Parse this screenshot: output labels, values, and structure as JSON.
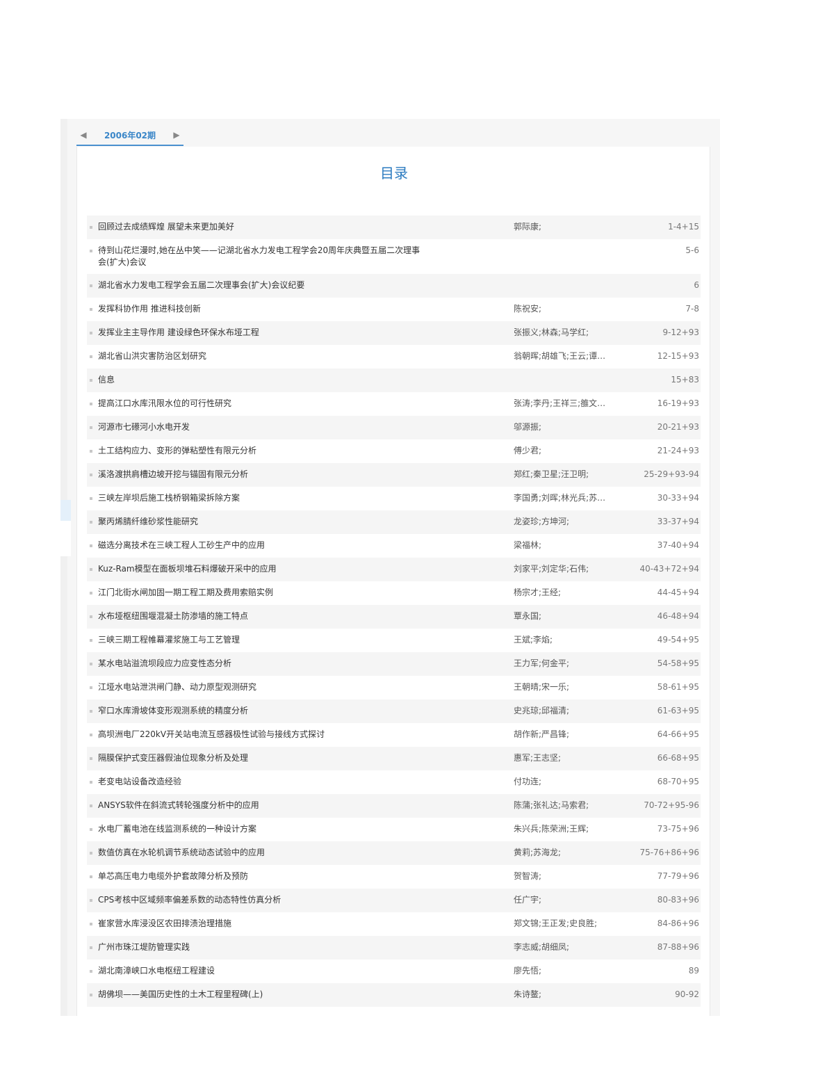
{
  "issue": {
    "label": "2006年02期",
    "prev_icon": "◀",
    "next_icon": "▶"
  },
  "toc": {
    "title": "目录",
    "articles": [
      {
        "title": "回顾过去成绩辉煌 展望未来更加美好",
        "authors": "郭际康;",
        "pages": "1-4+15"
      },
      {
        "title": "待到山花烂漫时,她在丛中笑——记湖北省水力发电工程学会20周年庆典暨五届二次理事会(扩大)会议",
        "authors": "",
        "pages": "5-6"
      },
      {
        "title": "湖北省水力发电工程学会五届二次理事会(扩大)会议纪要",
        "authors": "",
        "pages": "6"
      },
      {
        "title": "发挥科协作用 推进科技创新",
        "authors": "陈祝安;",
        "pages": "7-8"
      },
      {
        "title": "发挥业主主导作用 建设绿色环保水布垭工程",
        "authors": "张振义;林森;马学红;",
        "pages": "9-12+93"
      },
      {
        "title": "湖北省山洪灾害防治区划研究",
        "authors": "翁朝晖;胡雄飞;王云;谭…",
        "pages": "12-15+93"
      },
      {
        "title": "信息",
        "authors": "",
        "pages": "15+83"
      },
      {
        "title": "提高江口水库汛限水位的可行性研究",
        "authors": "张涛;李丹;王祥三;雒文…",
        "pages": "16-19+93"
      },
      {
        "title": "河源市七礤河小水电开发",
        "authors": "邬源振;",
        "pages": "20-21+93"
      },
      {
        "title": "土工结构应力、变形的弹粘塑性有限元分析",
        "authors": "傅少君;",
        "pages": "21-24+93"
      },
      {
        "title": "溪洛渡拱肩槽边坡开挖与锚固有限元分析",
        "authors": "郑红;秦卫星;汪卫明;",
        "pages": "25-29+93-94"
      },
      {
        "title": "三峡左岸坝后施工栈桥钢箱梁拆除方案",
        "authors": "李国勇;刘晖;林光兵;苏…",
        "pages": "30-33+94"
      },
      {
        "title": "聚丙烯腈纤维砂浆性能研究",
        "authors": "龙姿珍;方坤河;",
        "pages": "33-37+94"
      },
      {
        "title": "磁选分离技术在三峡工程人工砂生产中的应用",
        "authors": "梁福林;",
        "pages": "37-40+94"
      },
      {
        "title": "Kuz-Ram模型在面板坝堆石料爆破开采中的应用",
        "authors": "刘家平;刘定华;石伟;",
        "pages": "40-43+72+94"
      },
      {
        "title": "江门北街水闸加固一期工程工期及费用索赔实例",
        "authors": "杨宗才;王经;",
        "pages": "44-45+94"
      },
      {
        "title": "水布垭枢纽围堰混凝土防渗墙的施工特点",
        "authors": "覃永国;",
        "pages": "46-48+94"
      },
      {
        "title": "三峡三期工程帷幕灌浆施工与工艺管理",
        "authors": "王斌;李焰;",
        "pages": "49-54+95"
      },
      {
        "title": "某水电站溢流坝段应力应变性态分析",
        "authors": "王力军;何金平;",
        "pages": "54-58+95"
      },
      {
        "title": "江垭水电站泄洪闸门静、动力原型观测研究",
        "authors": "王朝晴;宋一乐;",
        "pages": "58-61+95"
      },
      {
        "title": "窄口水库滑坡体变形观测系统的精度分析",
        "authors": "史兆琼;邱福清;",
        "pages": "61-63+95"
      },
      {
        "title": "高坝洲电厂220kV开关站电流互感器极性试验与接线方式探讨",
        "authors": "胡作新;严昌锋;",
        "pages": "64-66+95"
      },
      {
        "title": "隔膜保护式变压器假油位现象分析及处理",
        "authors": "惠军;王志坚;",
        "pages": "66-68+95"
      },
      {
        "title": "老变电站设备改造经验",
        "authors": "付功连;",
        "pages": "68-70+95"
      },
      {
        "title": "ANSYS软件在斜流式转轮强度分析中的应用",
        "authors": "陈蒲;张礼达;马索君;",
        "pages": "70-72+95-96"
      },
      {
        "title": "水电厂蓄电池在线监测系统的一种设计方案",
        "authors": "朱兴兵;陈荣洲;王辉;",
        "pages": "73-75+96"
      },
      {
        "title": "数值仿真在水轮机调节系统动态试验中的应用",
        "authors": "黄莉;苏海龙;",
        "pages": "75-76+86+96"
      },
      {
        "title": "单芯高压电力电缆外护套故障分析及预防",
        "authors": "贺智涛;",
        "pages": "77-79+96"
      },
      {
        "title": "CPS考核中区域频率偏差系数的动态特性仿真分析",
        "authors": "任广宇;",
        "pages": "80-83+96"
      },
      {
        "title": "崔家营水库浸没区农田排渍治理措施",
        "authors": "郑文锦;王正发;史良胜;",
        "pages": "84-86+96"
      },
      {
        "title": "广州市珠江堤防管理实践",
        "authors": "李志威;胡细凤;",
        "pages": "87-88+96"
      },
      {
        "title": "湖北南漳峡口水电枢纽工程建设",
        "authors": "廖先悟;",
        "pages": "89"
      },
      {
        "title": "胡佛坝——美国历史性的土木工程里程碑(上)",
        "authors": "朱诗鳌;",
        "pages": "90-92"
      }
    ]
  }
}
